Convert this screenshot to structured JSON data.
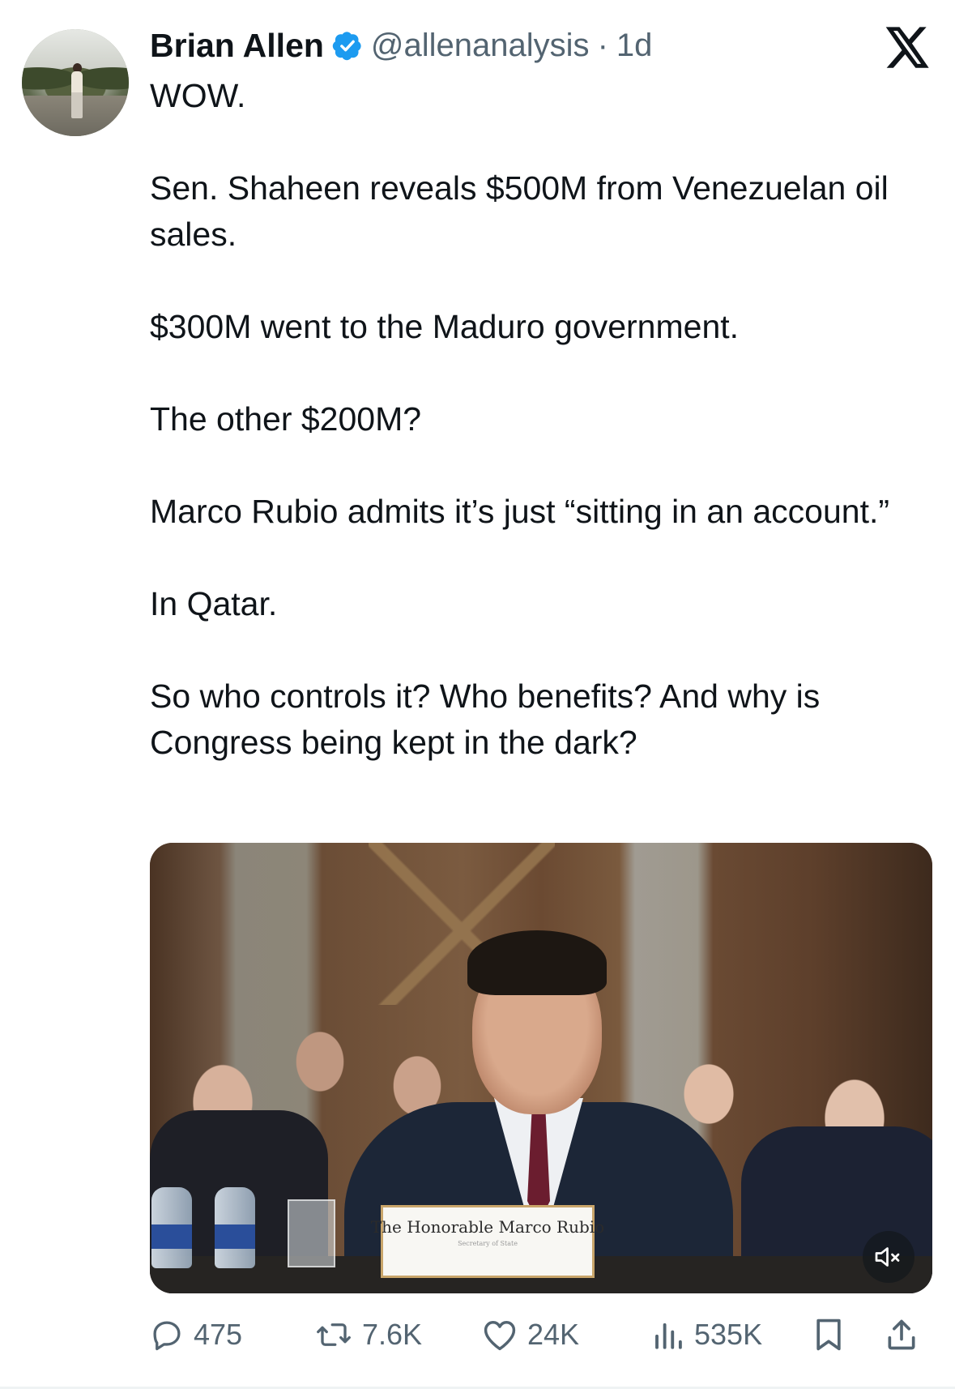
{
  "author": {
    "name": "Brian Allen",
    "handle": "@allenanalysis",
    "separator": "·",
    "time": "1d",
    "verified": true
  },
  "brand": {
    "logo": "x-logo-icon"
  },
  "tweet": {
    "paragraphs": [
      "WOW.",
      "Sen. Shaheen reveals $500M from Venezuelan oil sales.",
      "$300M went to the Maduro government.",
      "The other $200M?",
      "Marco Rubio admits it’s just “sitting in an account.”",
      "In Qatar.",
      "So who controls it? Who benefits? And why is Congress being kept in the dark?"
    ]
  },
  "media": {
    "type": "video",
    "nameplate_title": "The Honorable Marco Rubio",
    "nameplate_subtitle": "Secretary of State",
    "muted": true,
    "mute_icon": "speaker-muted-icon"
  },
  "actions": {
    "replies": "475",
    "reposts": "7.6K",
    "likes": "24K",
    "views": "535K",
    "reply_icon": "reply-icon",
    "repost_icon": "repost-icon",
    "like_icon": "heart-icon",
    "views_icon": "views-icon",
    "bookmark_icon": "bookmark-icon",
    "share_icon": "share-icon"
  },
  "colors": {
    "text": "#0f1419",
    "secondary": "#536471",
    "verified": "#1d9bf0"
  }
}
